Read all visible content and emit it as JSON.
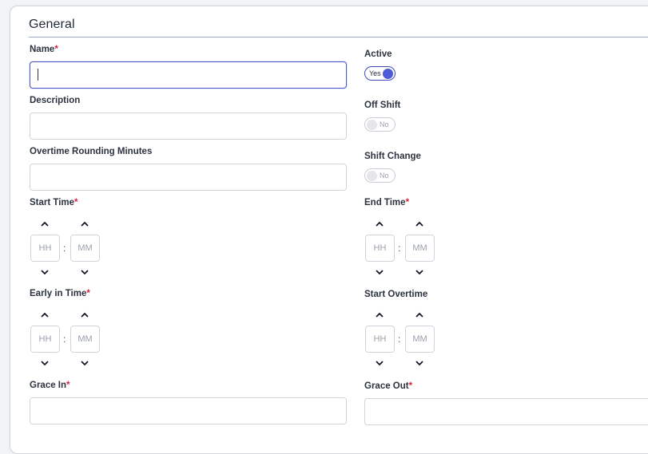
{
  "section": {
    "title": "General"
  },
  "fields": {
    "name": {
      "label": "Name",
      "required": "*",
      "value": ""
    },
    "description": {
      "label": "Description",
      "value": ""
    },
    "overtime_rounding": {
      "label": "Overtime Rounding Minutes",
      "value": ""
    },
    "start_time": {
      "label": "Start Time",
      "required": "*",
      "hh": "HH",
      "mm": "MM",
      "sep": ":"
    },
    "end_time": {
      "label": "End Time",
      "required": "*",
      "hh": "HH",
      "mm": "MM",
      "sep": ":"
    },
    "early_in_time": {
      "label": "Early in Time",
      "required": "*",
      "hh": "HH",
      "mm": "MM",
      "sep": ":"
    },
    "start_overtime": {
      "label": "Start Overtime",
      "hh": "HH",
      "mm": "MM",
      "sep": ":"
    },
    "grace_in": {
      "label": "Grace In",
      "required": "*",
      "value": ""
    },
    "grace_out": {
      "label": "Grace Out",
      "required": "*",
      "value": ""
    }
  },
  "toggles": {
    "active": {
      "label": "Active",
      "state": "Yes",
      "on": true
    },
    "off_shift": {
      "label": "Off Shift",
      "state": "No",
      "on": false
    },
    "shift_change": {
      "label": "Shift Change",
      "state": "No",
      "on": false
    }
  },
  "colors": {
    "accent": "#4d5bd6",
    "required": "#d4213d",
    "section_rule": "#9aa8d4"
  },
  "icons": {
    "up": "chevron-up-icon",
    "down": "chevron-down-icon"
  }
}
